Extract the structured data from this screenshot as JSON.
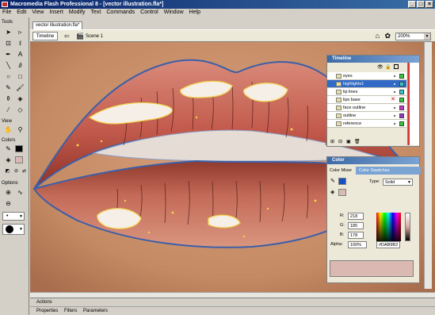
{
  "window": {
    "title": "Macromedia Flash Professional 8 - [vector illustration.fla*]",
    "buttons": [
      "_",
      "□",
      "×"
    ]
  },
  "menu": [
    "File",
    "Edit",
    "View",
    "Insert",
    "Modify",
    "Text",
    "Commands",
    "Control",
    "Window",
    "Help"
  ],
  "tools": {
    "header": "Tools",
    "view_header": "View",
    "colors_header": "Colors",
    "options_header": "Options"
  },
  "document": {
    "tab": "vector illustration.fla*",
    "timeline_button": "Timeline",
    "scene": "Scene 1",
    "zoom": "200%"
  },
  "timeline": {
    "title": "Timeline",
    "layers": [
      {
        "name": "eyes",
        "color": "#33cc33",
        "selected": false
      },
      {
        "name": "highlights1",
        "color": "#33cccc",
        "selected": true
      },
      {
        "name": "lip lines",
        "color": "#33cccc",
        "selected": false
      },
      {
        "name": "lips base",
        "color": "#33cc33",
        "selected": false
      },
      {
        "name": "face outline",
        "color": "#cc33cc",
        "selected": false
      },
      {
        "name": "outline",
        "color": "#9933cc",
        "selected": false
      },
      {
        "name": "reference",
        "color": "#33cc33",
        "selected": false
      }
    ]
  },
  "color": {
    "title": "Color",
    "tabs": [
      "Color Mixer",
      "Color Swatches"
    ],
    "type_label": "Type:",
    "type_value": "Solid",
    "r_label": "R:",
    "r": "218",
    "g_label": "G:",
    "g": "185",
    "b_label": "B:",
    "b": "178",
    "alpha_label": "Alpha:",
    "alpha": "100%",
    "hex": "#DAB9B2",
    "fill_color": "#dab9b2"
  },
  "bottom_panels": {
    "actions": "Actions",
    "properties": "Properties",
    "filters": "Filters",
    "parameters": "Parameters"
  }
}
